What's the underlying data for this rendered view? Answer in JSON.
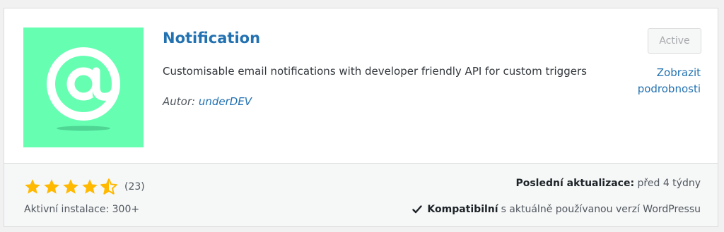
{
  "plugin": {
    "title": "Notification",
    "description": "Customisable email notifications with developer friendly API for custom triggers",
    "author_prefix": "Autor:",
    "author_name": "underDEV",
    "status_button": "Active",
    "details_link": "Zobrazit podrobnosti",
    "icon": "at-sign-icon",
    "icon_bg_color": "#66ffb2"
  },
  "footer": {
    "rating": 4.5,
    "rating_count": "(23)",
    "installs": "Aktivní instalace: 300+",
    "updated_label": "Poslední aktualizace:",
    "updated_value": "před 4 týdny",
    "compat_label": "Kompatibilní",
    "compat_text": "s aktuálně používanou verzí WordPressu"
  },
  "colors": {
    "link": "#2271b1",
    "star": "#ffb900"
  }
}
